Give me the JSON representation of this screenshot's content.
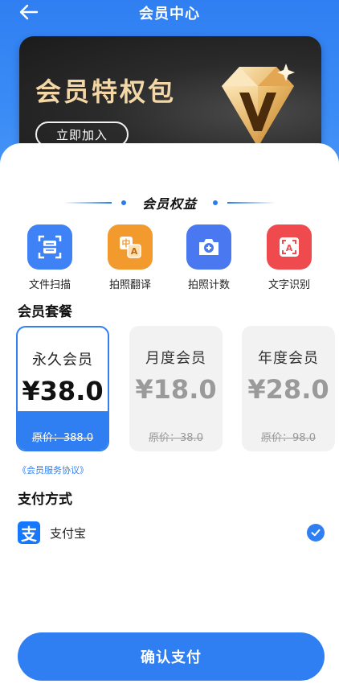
{
  "header": {
    "title": "会员中心",
    "back_icon": "back-arrow-icon"
  },
  "banner": {
    "title": "会员特权包",
    "join_label": "立即加入",
    "emblem_icon": "diamond-v-icon"
  },
  "rights": {
    "heading": "会员权益",
    "items": [
      {
        "label": "文件扫描",
        "icon": "document-scan-icon",
        "color": "#3e82f5"
      },
      {
        "label": "拍照翻译",
        "icon": "photo-translate-icon",
        "color": "#f29a2e"
      },
      {
        "label": "拍照计数",
        "icon": "camera-count-icon",
        "color": "#4a78f0"
      },
      {
        "label": "文字识别",
        "icon": "text-recognition-icon",
        "color": "#ef4b4f"
      }
    ]
  },
  "plans": {
    "heading": "会员套餐",
    "items": [
      {
        "name": "永久会员",
        "price": "¥38.0",
        "original": "原价：388.0",
        "selected": true
      },
      {
        "name": "月度会员",
        "price": "¥18.0",
        "original": "原价：38.0",
        "selected": false
      },
      {
        "name": "年度会员",
        "price": "¥28.0",
        "original": "原价：98.0",
        "selected": false
      }
    ],
    "agreement": "《会员服务协议》"
  },
  "payment": {
    "heading": "支付方式",
    "method_label": "支付宝",
    "method_icon_text": "支",
    "selected": true
  },
  "confirm_label": "确认支付",
  "colors": {
    "primary": "#2f7ff2",
    "gold": "#f3d7a7"
  }
}
